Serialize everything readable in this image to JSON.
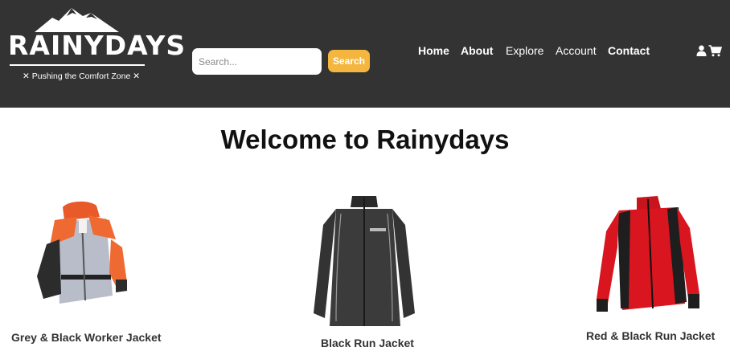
{
  "brand": {
    "name": "RAINYDAYS",
    "tagline": "✕ Pushing the Comfort Zone ✕"
  },
  "search": {
    "placeholder": "Search...",
    "button_label": "Search"
  },
  "nav": {
    "items": [
      {
        "label": "Home"
      },
      {
        "label": "About"
      },
      {
        "label": "Explore"
      },
      {
        "label": "Account"
      },
      {
        "label": "Contact"
      }
    ]
  },
  "icons": {
    "user": "user-icon",
    "cart": "cart-icon"
  },
  "main": {
    "title": "Welcome to Rainydays",
    "products": [
      {
        "name": "Grey & Black Worker Jacket"
      },
      {
        "name": "Black Run Jacket"
      },
      {
        "name": "Red & Black Run Jacket"
      }
    ]
  },
  "colors": {
    "header_bg": "#333333",
    "accent": "#f4b63f",
    "text_light": "#ffffff"
  }
}
